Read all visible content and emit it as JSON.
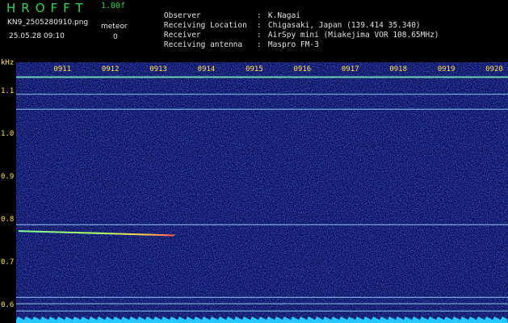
{
  "header": {
    "app_title": "HROFFT",
    "version": "1.00f",
    "file_name": "KN9_2505280910.png",
    "timestamp": "25.05.28 09:10",
    "meteor_label": "meteor",
    "meteor_count": "0"
  },
  "info": [
    {
      "key": "Observer",
      "value": "K.Nagai"
    },
    {
      "key": "Receiving Location",
      "value": "Chigasaki, Japan (139.414 35.340)"
    },
    {
      "key": "Receiver",
      "value": "AirSpy mini (Miakejima VOR 108.65MHz)"
    },
    {
      "key": "Receiving antenna",
      "value": "Maspro FM-3"
    }
  ],
  "chart_data": {
    "type": "heatmap",
    "ylabel": "kHz",
    "x_ticks": [
      "0911",
      "0912",
      "0913",
      "0914",
      "0915",
      "0916",
      "0917",
      "0918",
      "0919",
      "0920"
    ],
    "y_ticks": [
      1.1,
      1.0,
      0.9,
      0.8,
      0.7,
      0.6
    ],
    "y_range_khz": [
      0.56,
      1.17
    ],
    "x_range_min": [
      910.0,
      920.25
    ],
    "colors": {
      "background": "#0a0f5a",
      "noise": "#2b3bc0",
      "line": "#9fd9ff",
      "text": "#ffe34a"
    },
    "carrier_lines_khz": [
      1.135,
      1.095,
      1.06,
      0.79,
      0.62,
      0.605,
      0.588
    ],
    "echoes": [
      {
        "type": "meteor-trace",
        "start_time": "0910.05",
        "end_time": "0913.3",
        "start_khz": 0.775,
        "end_khz": 0.765
      }
    ]
  }
}
